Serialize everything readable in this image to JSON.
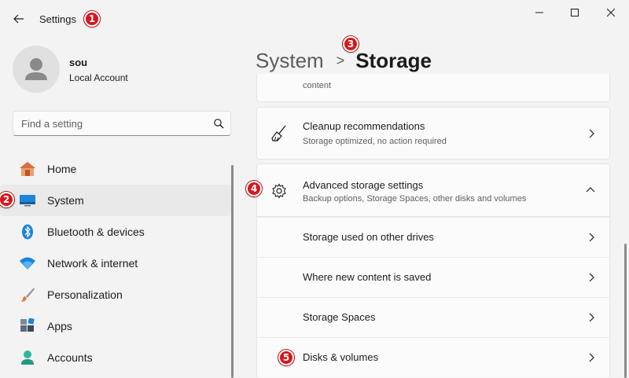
{
  "titlebar": {
    "title": "Settings",
    "back_icon": "arrow-left-icon",
    "minimize_icon": "minimize-icon",
    "maximize_icon": "maximize-icon",
    "close_icon": "close-icon"
  },
  "profile": {
    "name": "sou",
    "account_type": "Local Account"
  },
  "search": {
    "placeholder": "Find a setting"
  },
  "sidebar": {
    "items": [
      {
        "label": "Home",
        "icon": "home-icon"
      },
      {
        "label": "System",
        "icon": "system-monitor-icon",
        "active": true
      },
      {
        "label": "Bluetooth & devices",
        "icon": "bluetooth-icon"
      },
      {
        "label": "Network & internet",
        "icon": "wifi-icon"
      },
      {
        "label": "Personalization",
        "icon": "paintbrush-icon"
      },
      {
        "label": "Apps",
        "icon": "apps-icon"
      },
      {
        "label": "Accounts",
        "icon": "person-icon"
      }
    ]
  },
  "breadcrumb": {
    "parent": "System",
    "separator": ">",
    "current": "Storage"
  },
  "main": {
    "partial_card_sub": "content",
    "cleanup": {
      "title": "Cleanup recommendations",
      "subtitle": "Storage optimized, no action required"
    },
    "advanced": {
      "title": "Advanced storage settings",
      "subtitle": "Backup options, Storage Spaces, other disks and volumes"
    },
    "advanced_items": [
      {
        "label": "Storage used on other drives"
      },
      {
        "label": "Where new content is saved"
      },
      {
        "label": "Storage Spaces"
      },
      {
        "label": "Disks & volumes"
      }
    ]
  },
  "callouts": [
    "1",
    "2",
    "3",
    "4",
    "5"
  ],
  "colors": {
    "callout": "#d8161b",
    "accent": "#0067c0",
    "background": "#f3f3f3",
    "card": "#fbfbfb"
  }
}
